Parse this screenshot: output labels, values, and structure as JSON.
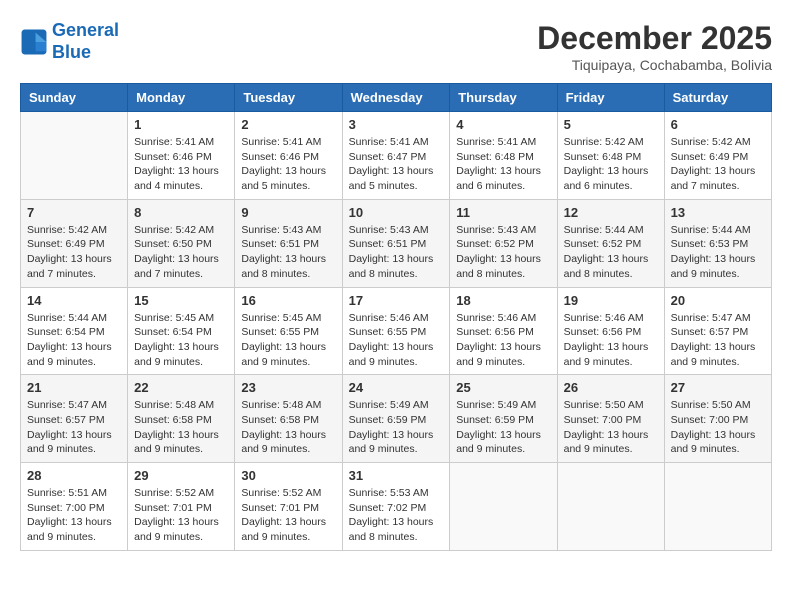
{
  "header": {
    "logo_line1": "General",
    "logo_line2": "Blue",
    "month": "December 2025",
    "location": "Tiquipaya, Cochabamba, Bolivia"
  },
  "weekdays": [
    "Sunday",
    "Monday",
    "Tuesday",
    "Wednesday",
    "Thursday",
    "Friday",
    "Saturday"
  ],
  "weeks": [
    [
      {
        "day": "",
        "info": ""
      },
      {
        "day": "1",
        "info": "Sunrise: 5:41 AM\nSunset: 6:46 PM\nDaylight: 13 hours\nand 4 minutes."
      },
      {
        "day": "2",
        "info": "Sunrise: 5:41 AM\nSunset: 6:46 PM\nDaylight: 13 hours\nand 5 minutes."
      },
      {
        "day": "3",
        "info": "Sunrise: 5:41 AM\nSunset: 6:47 PM\nDaylight: 13 hours\nand 5 minutes."
      },
      {
        "day": "4",
        "info": "Sunrise: 5:41 AM\nSunset: 6:48 PM\nDaylight: 13 hours\nand 6 minutes."
      },
      {
        "day": "5",
        "info": "Sunrise: 5:42 AM\nSunset: 6:48 PM\nDaylight: 13 hours\nand 6 minutes."
      },
      {
        "day": "6",
        "info": "Sunrise: 5:42 AM\nSunset: 6:49 PM\nDaylight: 13 hours\nand 7 minutes."
      }
    ],
    [
      {
        "day": "7",
        "info": "Sunrise: 5:42 AM\nSunset: 6:49 PM\nDaylight: 13 hours\nand 7 minutes."
      },
      {
        "day": "8",
        "info": "Sunrise: 5:42 AM\nSunset: 6:50 PM\nDaylight: 13 hours\nand 7 minutes."
      },
      {
        "day": "9",
        "info": "Sunrise: 5:43 AM\nSunset: 6:51 PM\nDaylight: 13 hours\nand 8 minutes."
      },
      {
        "day": "10",
        "info": "Sunrise: 5:43 AM\nSunset: 6:51 PM\nDaylight: 13 hours\nand 8 minutes."
      },
      {
        "day": "11",
        "info": "Sunrise: 5:43 AM\nSunset: 6:52 PM\nDaylight: 13 hours\nand 8 minutes."
      },
      {
        "day": "12",
        "info": "Sunrise: 5:44 AM\nSunset: 6:52 PM\nDaylight: 13 hours\nand 8 minutes."
      },
      {
        "day": "13",
        "info": "Sunrise: 5:44 AM\nSunset: 6:53 PM\nDaylight: 13 hours\nand 9 minutes."
      }
    ],
    [
      {
        "day": "14",
        "info": "Sunrise: 5:44 AM\nSunset: 6:54 PM\nDaylight: 13 hours\nand 9 minutes."
      },
      {
        "day": "15",
        "info": "Sunrise: 5:45 AM\nSunset: 6:54 PM\nDaylight: 13 hours\nand 9 minutes."
      },
      {
        "day": "16",
        "info": "Sunrise: 5:45 AM\nSunset: 6:55 PM\nDaylight: 13 hours\nand 9 minutes."
      },
      {
        "day": "17",
        "info": "Sunrise: 5:46 AM\nSunset: 6:55 PM\nDaylight: 13 hours\nand 9 minutes."
      },
      {
        "day": "18",
        "info": "Sunrise: 5:46 AM\nSunset: 6:56 PM\nDaylight: 13 hours\nand 9 minutes."
      },
      {
        "day": "19",
        "info": "Sunrise: 5:46 AM\nSunset: 6:56 PM\nDaylight: 13 hours\nand 9 minutes."
      },
      {
        "day": "20",
        "info": "Sunrise: 5:47 AM\nSunset: 6:57 PM\nDaylight: 13 hours\nand 9 minutes."
      }
    ],
    [
      {
        "day": "21",
        "info": "Sunrise: 5:47 AM\nSunset: 6:57 PM\nDaylight: 13 hours\nand 9 minutes."
      },
      {
        "day": "22",
        "info": "Sunrise: 5:48 AM\nSunset: 6:58 PM\nDaylight: 13 hours\nand 9 minutes."
      },
      {
        "day": "23",
        "info": "Sunrise: 5:48 AM\nSunset: 6:58 PM\nDaylight: 13 hours\nand 9 minutes."
      },
      {
        "day": "24",
        "info": "Sunrise: 5:49 AM\nSunset: 6:59 PM\nDaylight: 13 hours\nand 9 minutes."
      },
      {
        "day": "25",
        "info": "Sunrise: 5:49 AM\nSunset: 6:59 PM\nDaylight: 13 hours\nand 9 minutes."
      },
      {
        "day": "26",
        "info": "Sunrise: 5:50 AM\nSunset: 7:00 PM\nDaylight: 13 hours\nand 9 minutes."
      },
      {
        "day": "27",
        "info": "Sunrise: 5:50 AM\nSunset: 7:00 PM\nDaylight: 13 hours\nand 9 minutes."
      }
    ],
    [
      {
        "day": "28",
        "info": "Sunrise: 5:51 AM\nSunset: 7:00 PM\nDaylight: 13 hours\nand 9 minutes."
      },
      {
        "day": "29",
        "info": "Sunrise: 5:52 AM\nSunset: 7:01 PM\nDaylight: 13 hours\nand 9 minutes."
      },
      {
        "day": "30",
        "info": "Sunrise: 5:52 AM\nSunset: 7:01 PM\nDaylight: 13 hours\nand 9 minutes."
      },
      {
        "day": "31",
        "info": "Sunrise: 5:53 AM\nSunset: 7:02 PM\nDaylight: 13 hours\nand 8 minutes."
      },
      {
        "day": "",
        "info": ""
      },
      {
        "day": "",
        "info": ""
      },
      {
        "day": "",
        "info": ""
      }
    ]
  ]
}
